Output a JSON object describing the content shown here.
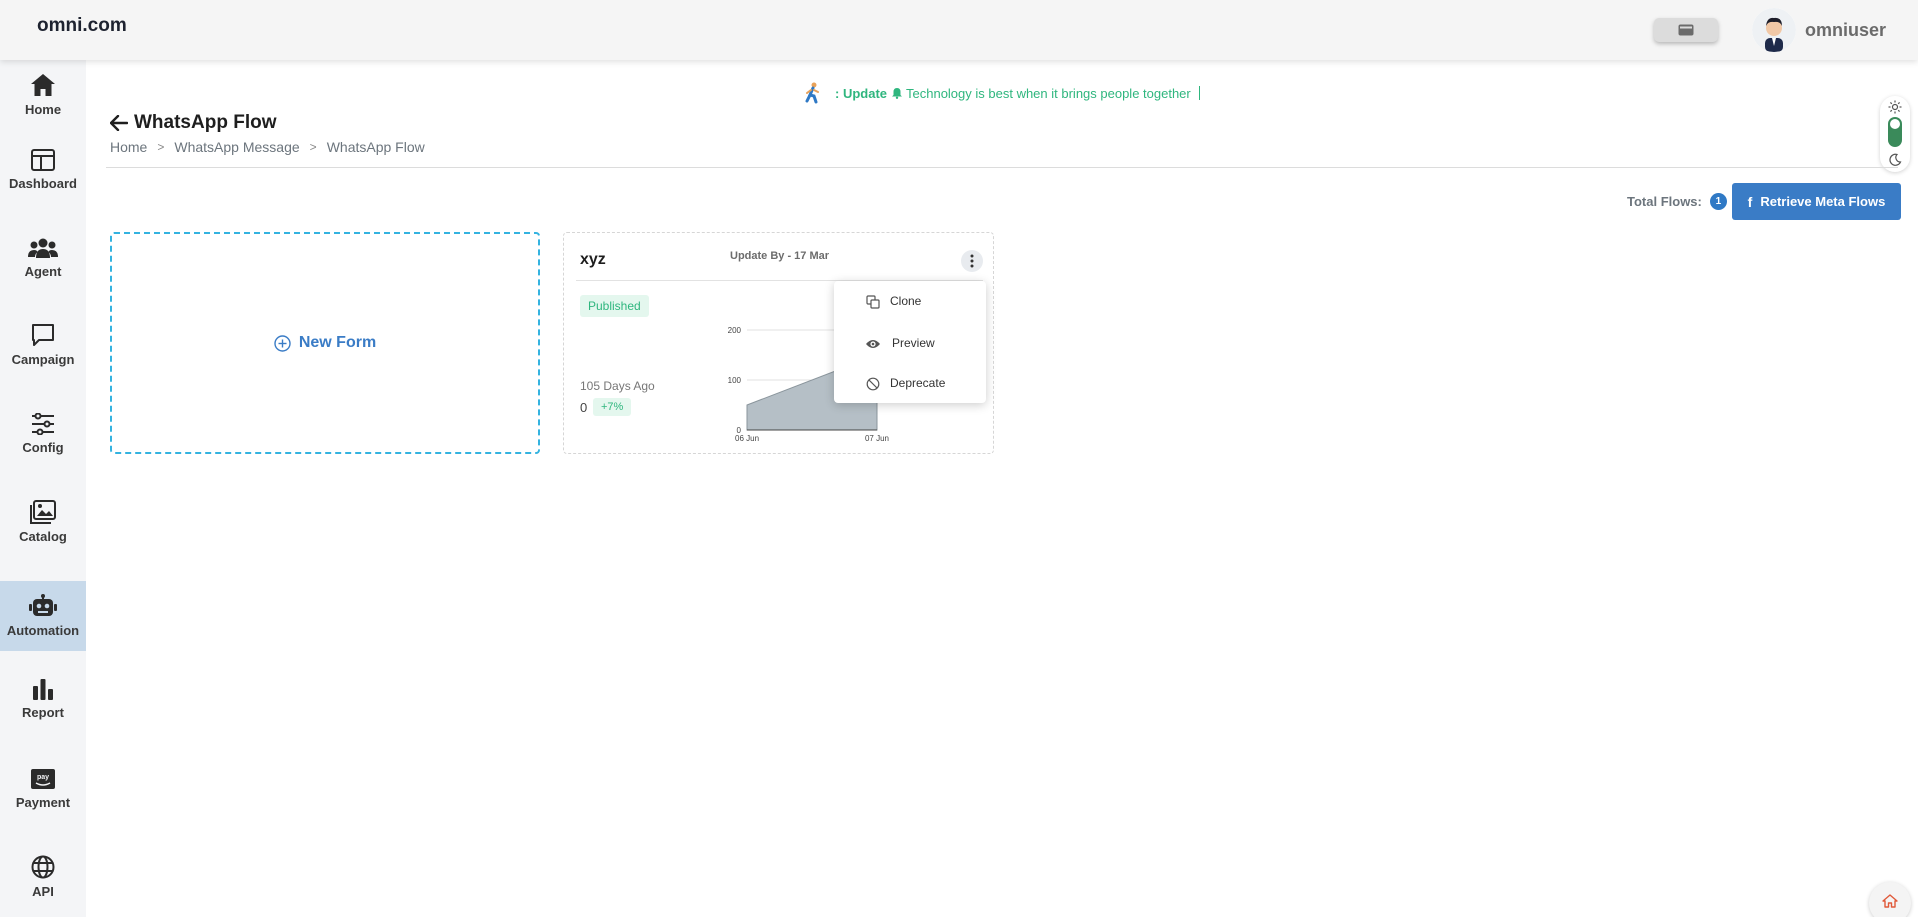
{
  "header": {
    "logo": "omni.com",
    "username": "omniuser"
  },
  "sidebar": {
    "items": [
      {
        "label": "Home",
        "icon": "home-icon"
      },
      {
        "label": "Dashboard",
        "icon": "dashboard-icon"
      },
      {
        "label": "Agent",
        "icon": "agent-icon"
      },
      {
        "label": "Campaign",
        "icon": "campaign-icon"
      },
      {
        "label": "Config",
        "icon": "config-icon"
      },
      {
        "label": "Catalog",
        "icon": "catalog-icon"
      },
      {
        "label": "Automation",
        "icon": "automation-icon",
        "active": true
      },
      {
        "label": "Report",
        "icon": "report-icon"
      },
      {
        "label": "Payment",
        "icon": "payment-icon"
      },
      {
        "label": "API",
        "icon": "api-icon"
      }
    ]
  },
  "ticker": {
    "prefix": ": Update",
    "message": "Technology is best when it brings people together"
  },
  "page": {
    "title": "WhatsApp Flow",
    "breadcrumb": [
      "Home",
      "WhatsApp Message",
      "WhatsApp Flow"
    ]
  },
  "toolbar": {
    "total_label": "Total Flows:",
    "total_count": "1",
    "retrieve_label": "Retrieve Meta Flows"
  },
  "new_form": {
    "label": "New Form"
  },
  "flow_card": {
    "name": "xyz",
    "updated": "Update By - 17 Mar",
    "status": "Published",
    "ago": "105 Days Ago",
    "count": "0",
    "change": "+7%"
  },
  "chart_data": {
    "type": "area",
    "x": [
      "06 Jun",
      "07 Jun"
    ],
    "values": [
      50,
      150
    ],
    "yticks": [
      "0",
      "100",
      "200"
    ],
    "ylim": [
      0,
      200
    ],
    "grid": true,
    "fill_color": "#b5bfc6"
  },
  "menu": {
    "items": [
      {
        "label": "Clone",
        "icon": "clone-icon"
      },
      {
        "label": "Preview",
        "icon": "eye-icon"
      },
      {
        "label": "Deprecate",
        "icon": "ban-icon"
      }
    ]
  },
  "colors": {
    "accent": "#3a7cc6",
    "success": "#2fb67e",
    "sidebar_active": "#c7d9ea"
  }
}
